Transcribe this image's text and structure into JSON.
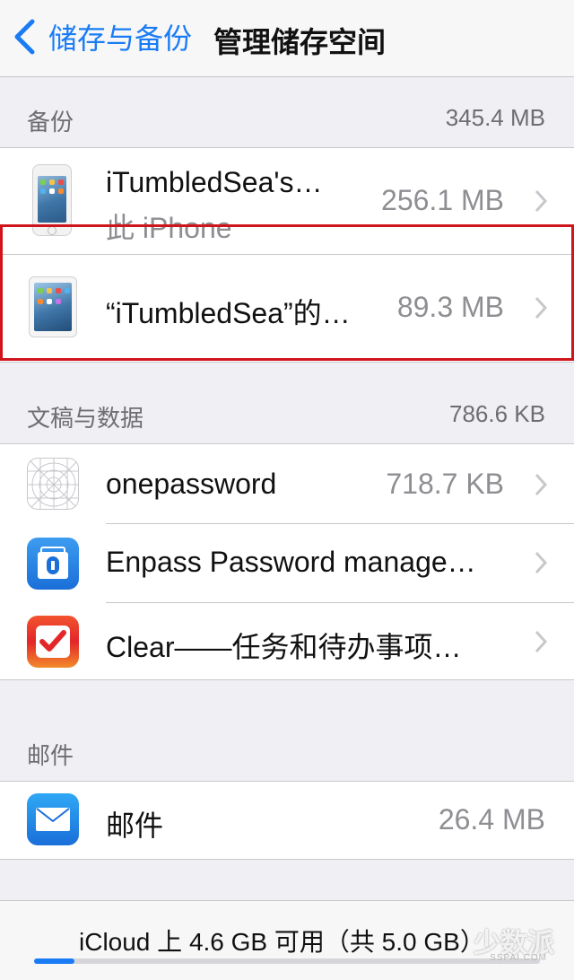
{
  "nav": {
    "back_label": "储存与备份",
    "title": "管理储存空间"
  },
  "backup": {
    "header": "备份",
    "total": "345.4 MB",
    "items": [
      {
        "title": "iTumbledSea's…",
        "subtitle": "此 iPhone",
        "size": "256.1 MB",
        "icon": "iphone-icon"
      },
      {
        "title": "“iTumbledSea”的…",
        "size": "89.3 MB",
        "icon": "ipad-icon"
      }
    ]
  },
  "documents": {
    "header": "文稿与数据",
    "total": "786.6 KB",
    "items": [
      {
        "title": "onepassword",
        "size": "718.7 KB",
        "icon": "placeholder-app-icon"
      },
      {
        "title": "Enpass Password manage…",
        "size": "",
        "icon": "enpass-app-icon"
      },
      {
        "title": "Clear——任务和待办事项…",
        "size": "",
        "icon": "clear-app-icon"
      }
    ]
  },
  "mail": {
    "header": "邮件",
    "items": [
      {
        "title": "邮件",
        "size": "26.4 MB",
        "icon": "mail-app-icon"
      }
    ]
  },
  "footer": {
    "storage_text": "iCloud 上 4.6 GB 可用（共 5.0 GB）",
    "used_fraction": 0.08,
    "watermark": "少数派",
    "watermark_sub": "SSPAI.COM"
  },
  "colors": {
    "accent": "#1a7cf5",
    "highlight": "#d0141b"
  }
}
